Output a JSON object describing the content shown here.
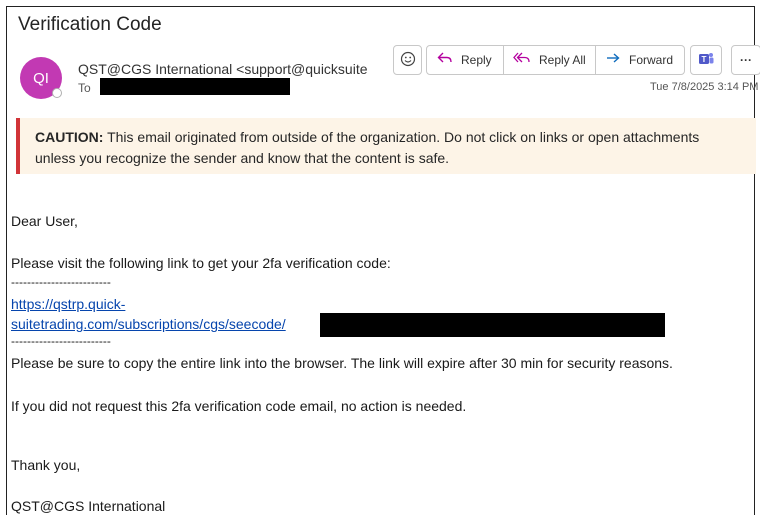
{
  "email": {
    "subject": "Verification Code",
    "avatar_initials": "QI",
    "sender": "QST@CGS International <support@quicksuite",
    "to_label": "To",
    "date": "Tue 7/8/2025 3:14 PM",
    "actions": {
      "emoji_icon": "smiley-icon",
      "reply": "Reply",
      "reply_all": "Reply All",
      "forward": "Forward",
      "teams_icon": "teams-icon",
      "more": "···"
    }
  },
  "caution": {
    "label": "CAUTION:",
    "line1": " This email originated from outside of the organization. Do not click on links or open attachments",
    "line2": "unless you recognize the sender and know that the content is safe."
  },
  "body": {
    "greeting": "Dear User,",
    "instruction": "Please visit the following link to get your 2fa verification code:",
    "separator1": "-------------------------",
    "link_line1": "https://qstrp.quick-",
    "link_line2": "suitetrading.com/subscriptions/cgs/seecode/",
    "separator2": "-------------------------",
    "copy_note": "Please be sure to copy the entire link into the browser. The link will expire after 30 min for security reasons.",
    "no_action": "If you did not request this 2fa verification code email, no action is needed.",
    "thanks": "Thank you,",
    "signature": "QST@CGS International"
  }
}
